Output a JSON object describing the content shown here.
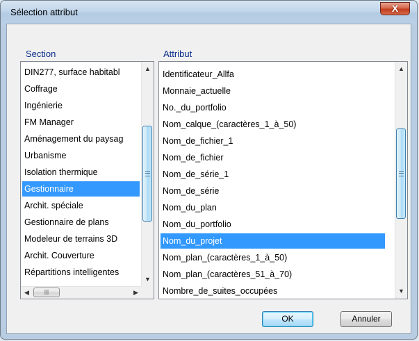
{
  "window": {
    "title": "Sélection attribut",
    "close_glyph": "X"
  },
  "section": {
    "label": "Section",
    "items": [
      "DIN277, surface habitabl",
      "Coffrage",
      "Ingénierie",
      "FM Manager",
      "Aménagement du paysag",
      "Urbanisme",
      "Isolation thermique",
      "Gestionnaire",
      "Archit. spéciale",
      "Gestionnaire de plans",
      "Modeleur de terrains 3D",
      "Archit. Couverture",
      "Répartitions intelligentes"
    ],
    "selected_index": 7
  },
  "attribut": {
    "label": "Attribut",
    "items": [
      "Identificateur_Allfa",
      "Monnaie_actuelle",
      "No._du_portfolio",
      "Nom_calque_(caractères_1_à_50)",
      "Nom_de_fichier_1",
      "Nom_de_fichier",
      "Nom_de_série_1",
      "Nom_de_série",
      "Nom_du_plan",
      "Nom_du_portfolio",
      "Nom_du_projet",
      "Nom_plan_(caractères_1_à_50)",
      "Nom_plan_(caractères_51_à_70)",
      "Nombre_de_suites_occupées"
    ],
    "selected_index": 10
  },
  "buttons": {
    "ok": "OK",
    "cancel": "Annuler"
  },
  "colors": {
    "selection": "#3399ff",
    "group_label": "#0a2d8a"
  }
}
